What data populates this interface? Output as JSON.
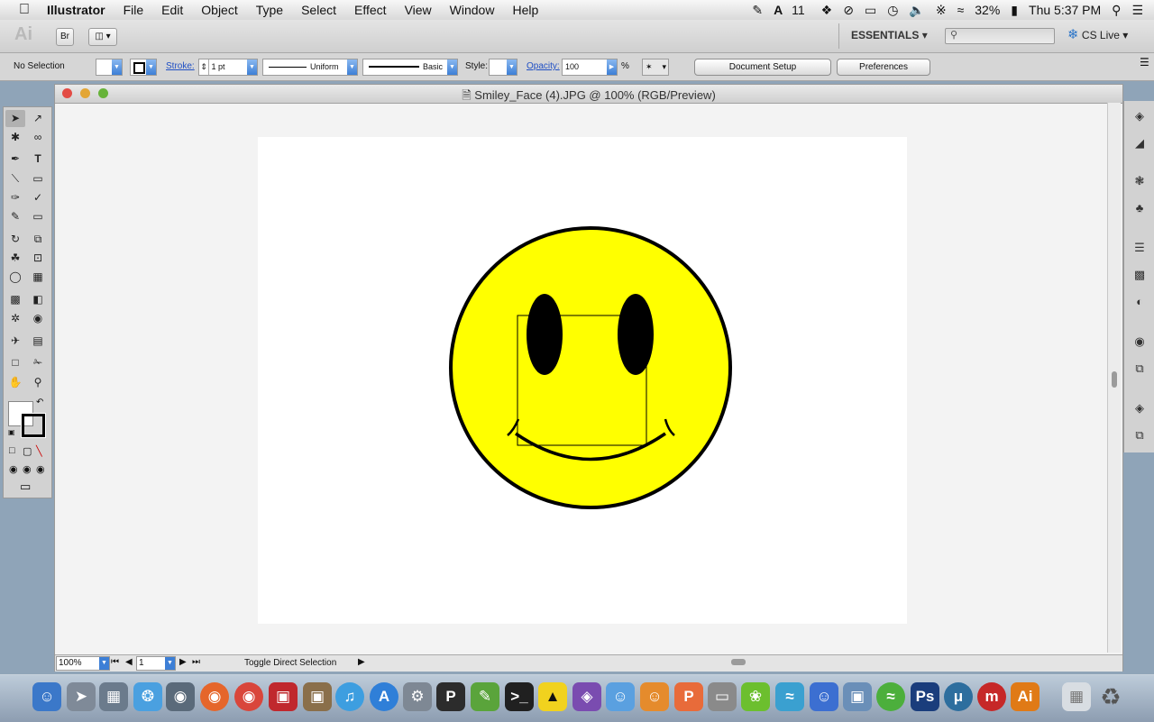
{
  "menubar": {
    "app_name": "Illustrator",
    "items": [
      "File",
      "Edit",
      "Object",
      "Type",
      "Select",
      "Effect",
      "View",
      "Window",
      "Help"
    ],
    "status": {
      "adobe_badge": "11",
      "battery": "32%",
      "clock": "Thu 5:37 PM"
    }
  },
  "appbar": {
    "logo": "Ai",
    "bridge": "Br",
    "workspace": "ESSENTIALS",
    "cslive": "CS Live"
  },
  "control": {
    "selection": "No Selection",
    "stroke_label": "Stroke:",
    "stroke_weight": "1 pt",
    "profile": "Uniform",
    "brush": "Basic",
    "style_label": "Style:",
    "opacity_label": "Opacity:",
    "opacity_value": "100",
    "percent": "%",
    "document_setup": "Document Setup",
    "preferences": "Preferences"
  },
  "document": {
    "title": "Smiley_Face (4).JPG @ 100% (RGB/Preview)",
    "zoom": "100%",
    "artboard_number": "1",
    "status_text": "Toggle Direct Selection"
  },
  "colors": {
    "face": "#ffff00",
    "outline": "#000000",
    "accent": "#3d7fd6"
  },
  "icons": {
    "tools": [
      "selection-tool-icon",
      "direct-selection-tool-icon",
      "magic-wand-icon",
      "lasso-icon",
      "pen-icon",
      "type-icon",
      "line-segment-icon",
      "rectangle-icon",
      "paintbrush-icon",
      "blob-brush-icon",
      "pencil-icon",
      "eraser-icon",
      "rotate-icon",
      "scale-icon",
      "warp-icon",
      "free-transform-icon",
      "shape-builder-icon",
      "perspective-grid-icon",
      "mesh-icon",
      "gradient-icon",
      "eyedropper-icon",
      "blend-icon",
      "symbol-sprayer-icon",
      "column-graph-icon",
      "artboard-icon",
      "slice-icon",
      "hand-icon",
      "zoom-icon"
    ]
  }
}
